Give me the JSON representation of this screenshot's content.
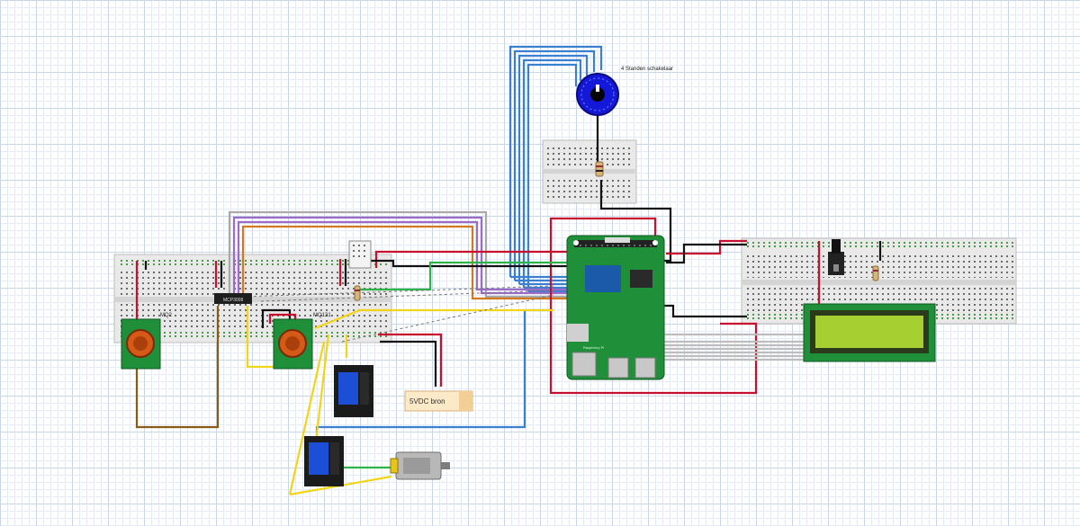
{
  "labels": {
    "switch": "4 Standen schakelaar",
    "sensor_left": "MQ2",
    "sensor_right": "MQ131",
    "adc_chip": "MCP3008",
    "power_supply": "5VDC bron",
    "pi_brand": "Raspberry Pi"
  },
  "colors": {
    "red": "#c8102e",
    "black": "#111111",
    "blue": "#3a7fd0",
    "yellow": "#f2d418",
    "green": "#2db34a",
    "brown": "#8b5a14",
    "orange": "#d2781e",
    "purple": "#9b6bc9",
    "gray": "#9a9a9a",
    "board_green": "#1f8f3a",
    "relay_blue": "#1c4fd6",
    "lcd_screen": "#a6cf32"
  }
}
